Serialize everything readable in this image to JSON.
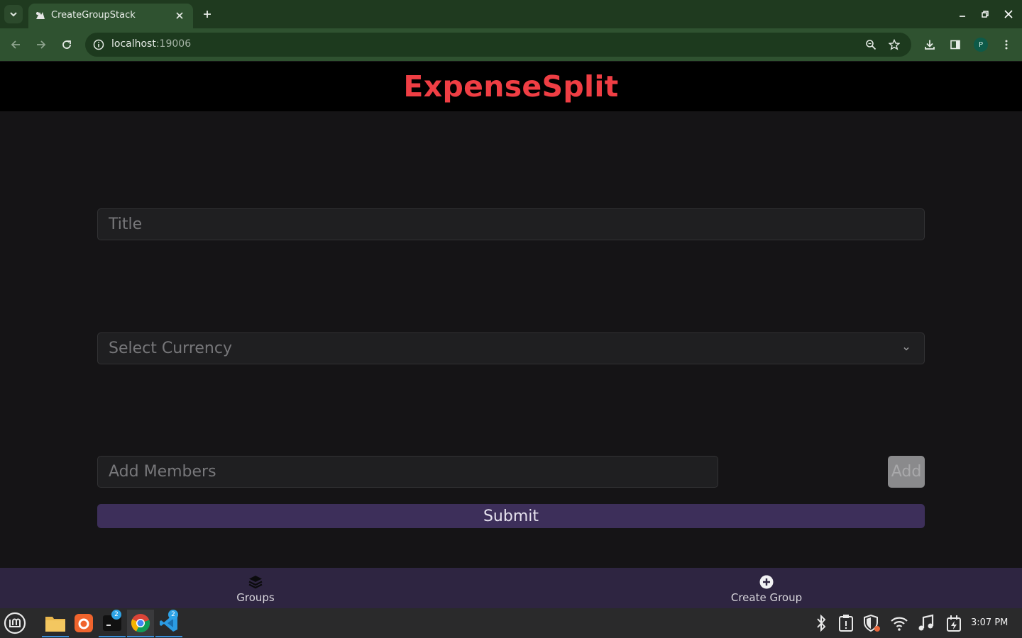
{
  "browser": {
    "tab_title": "CreateGroupStack",
    "url_host": "localhost",
    "url_port": ":19006",
    "profile_initial": "P"
  },
  "app": {
    "title": "ExpenseSplit",
    "title_color": "#ef3e44"
  },
  "form": {
    "title_placeholder": "Title",
    "currency_placeholder": "Select Currency",
    "members_placeholder": "Add Members",
    "add_label": "Add",
    "submit_label": "Submit"
  },
  "bottom_nav": {
    "items": [
      {
        "label": "Groups",
        "icon": "layers-icon"
      },
      {
        "label": "Create Group",
        "icon": "plus-circle-icon"
      }
    ]
  },
  "taskbar": {
    "terminal_badge": "2",
    "vscode_badge": "2",
    "clock": "3:07 PM"
  }
}
